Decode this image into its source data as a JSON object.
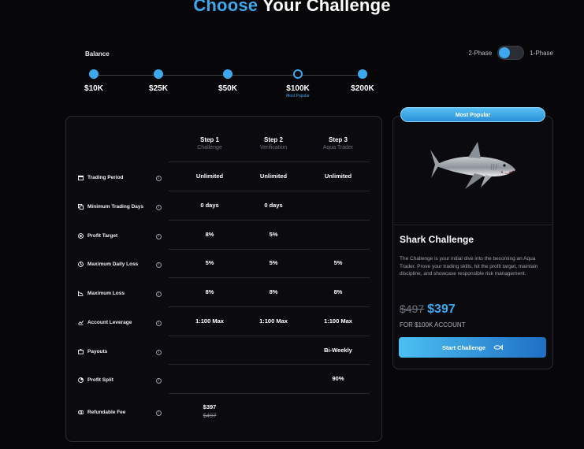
{
  "header": {
    "title_accent": "Choose",
    "title_rest": " Your Challenge"
  },
  "balance": {
    "label": "Balance",
    "options": [
      {
        "amount": "$10K"
      },
      {
        "amount": "$25K"
      },
      {
        "amount": "$50K"
      },
      {
        "amount": "$100K",
        "badge": "Most Popular",
        "selected": true
      },
      {
        "amount": "$200K"
      }
    ]
  },
  "phase_toggle": {
    "left_label": "2-Phase",
    "right_label": "1-Phase",
    "selected": "2-Phase"
  },
  "table": {
    "columns": [
      {
        "title": "Step 1",
        "subtitle": "Challenge"
      },
      {
        "title": "Step 2",
        "subtitle": "Verification"
      },
      {
        "title": "Step 3",
        "subtitle": "Aqua Trader"
      }
    ],
    "rows": [
      {
        "label": "Trading Period",
        "icon": "calendar-icon",
        "values": [
          "Unlimited",
          "Unlimited",
          "Unlimited"
        ]
      },
      {
        "label": "Minimum Trading Days",
        "icon": "days-icon",
        "values": [
          "0 days",
          "0 days",
          ""
        ]
      },
      {
        "label": "Profit Target",
        "icon": "target-icon",
        "values": [
          "8%",
          "5%",
          ""
        ]
      },
      {
        "label": "Maximum Daily Loss",
        "icon": "daily-loss-icon",
        "values": [
          "5%",
          "5%",
          "5%"
        ]
      },
      {
        "label": "Maximum Loss",
        "icon": "chart-down-icon",
        "values": [
          "8%",
          "8%",
          "8%"
        ]
      },
      {
        "label": "Account Leverage",
        "icon": "leverage-icon",
        "values": [
          "1:100 Max",
          "1:100 Max",
          "1:100 Max"
        ]
      },
      {
        "label": "Payouts",
        "icon": "payout-icon",
        "values": [
          "",
          "",
          "Bi-Weekly"
        ]
      },
      {
        "label": "Profit Split",
        "icon": "split-icon",
        "values": [
          "",
          "",
          "90%"
        ]
      },
      {
        "label": "Refundable Fee",
        "icon": "fee-icon",
        "values": [
          "$397",
          "",
          ""
        ],
        "old_value": "$497"
      }
    ]
  },
  "offer": {
    "badge": "Most Popular",
    "title": "Shark Challenge",
    "description": "The Challenge is your initial dive into the becoming an Aqua Trader. Prove your trading skills, hit the profit target, maintain discipline, and showcase responsible risk management.",
    "price_old": "$497",
    "price_new": "$397",
    "account": "FOR $100K ACCOUNT",
    "cta": "Start Challenge"
  },
  "colors": {
    "accent": "#3ea8ef",
    "background": "#07070a",
    "card": "#0b0b0f"
  }
}
